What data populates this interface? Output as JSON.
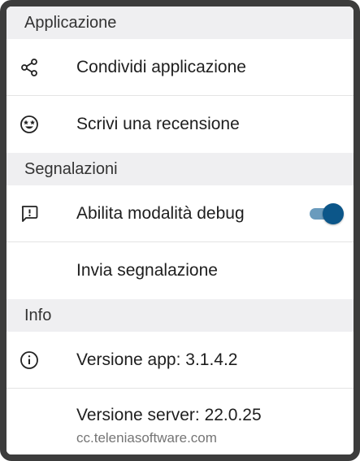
{
  "sections": {
    "applicazione": {
      "header": "Applicazione",
      "items": [
        {
          "label": "Condividi applicazione",
          "icon": "share-icon"
        },
        {
          "label": "Scrivi una recensione",
          "icon": "star-struck-emoji-icon"
        }
      ]
    },
    "segnalazioni": {
      "header": "Segnalazioni",
      "items": [
        {
          "label": "Abilita modalità debug",
          "icon": "feedback-alert-icon",
          "toggle_on": true
        },
        {
          "label": "Invia segnalazione"
        }
      ]
    },
    "info": {
      "header": "Info",
      "items": [
        {
          "label": "Versione app: 3.1.4.2",
          "icon": "info-circle-icon"
        },
        {
          "label": "Versione server: 22.0.25",
          "sublabel": "cc.teleniasoftware.com"
        }
      ]
    }
  },
  "colors": {
    "header_bg": "#efeff1",
    "toggle_thumb": "#0c5689",
    "toggle_track": "#6a9bbd",
    "frame": "#3c3c3c"
  }
}
